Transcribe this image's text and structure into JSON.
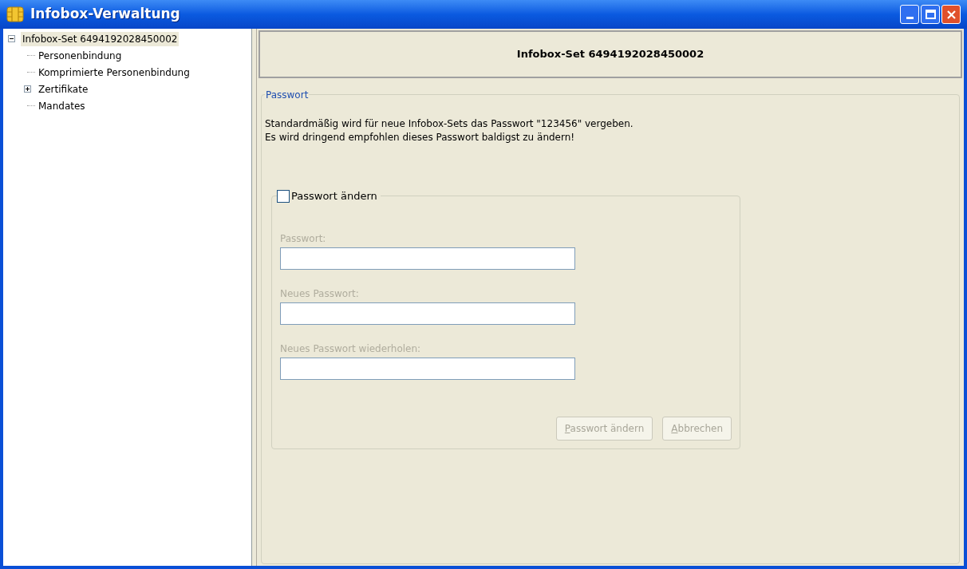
{
  "window": {
    "title": "Infobox-Verwaltung"
  },
  "tree": [
    {
      "label": "Infobox-Set 6494192028450002",
      "selected": true,
      "expanded": true,
      "children": [
        {
          "label": "Personenbindung",
          "selected": false
        },
        {
          "label": "Komprimierte Personenbindung",
          "selected": false
        },
        {
          "label": "Zertifikate",
          "selected": false,
          "expanded": false
        },
        {
          "label": "Mandates",
          "selected": false
        }
      ]
    }
  ],
  "header": {
    "title": "Infobox-Set 6494192028450002"
  },
  "password_group": {
    "title": "Passwort",
    "lines": [
      "Standardmäßig wird für neue Infobox-Sets das Passwort \"123456\" vergeben.",
      "Es wird dringend empfohlen dieses Passwort baldigst zu ändern!"
    ],
    "change": {
      "label": "Passwort ändern",
      "checked": false,
      "fields": [
        {
          "label": "Passwort:",
          "disabled": true
        },
        {
          "label": "Neues Passwort:",
          "disabled": true
        },
        {
          "label": "Neues Passwort wiederholen:",
          "disabled": true
        }
      ],
      "buttons": [
        {
          "label": "Passwort ändern",
          "disabled": true
        },
        {
          "label": "Abbrechen",
          "disabled": true
        }
      ]
    }
  }
}
